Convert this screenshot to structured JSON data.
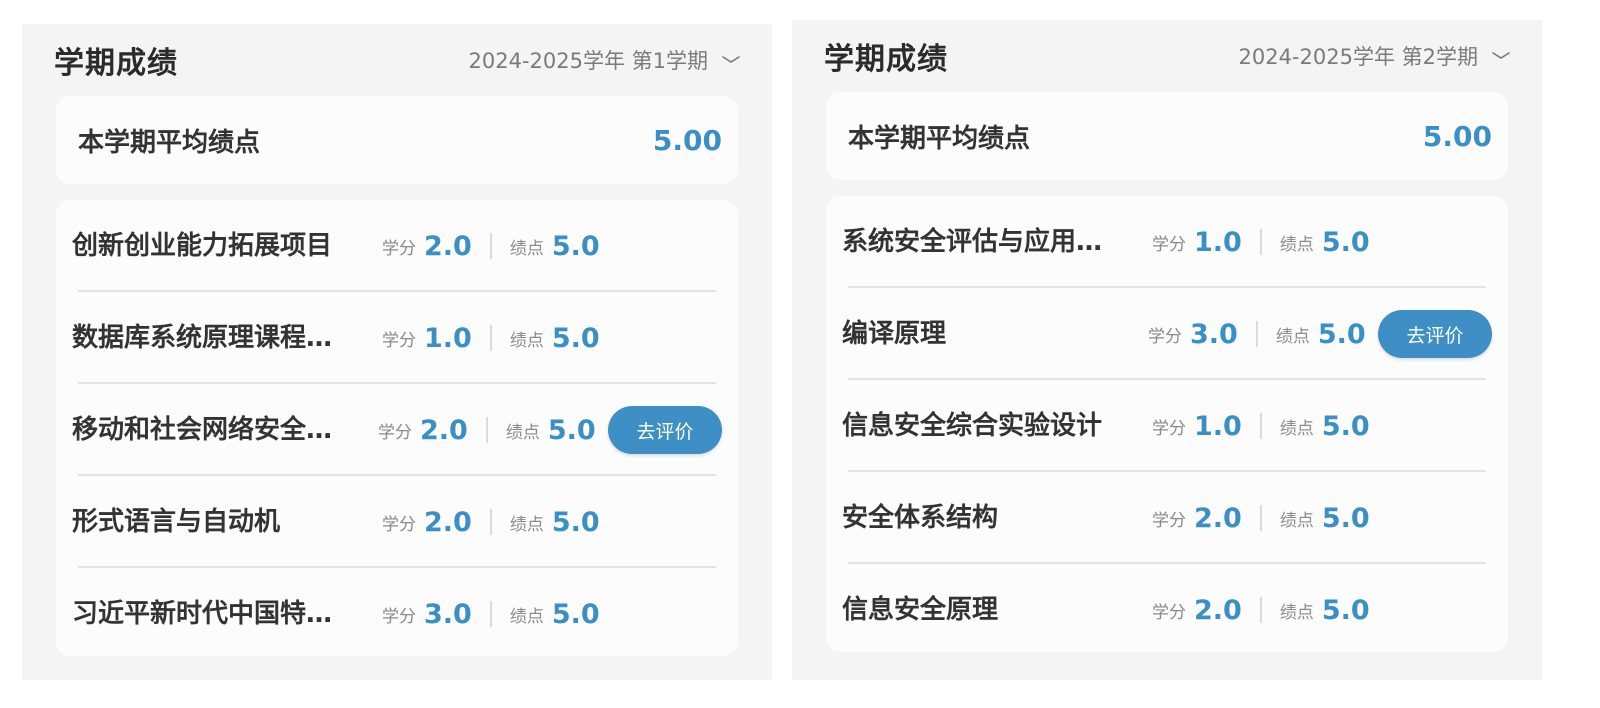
{
  "panels": [
    {
      "title": "学期成绩",
      "term": "2024-2025学年 第1学期",
      "gpa_label": "本学期平均绩点",
      "gpa_value": "5.00",
      "credit_label": "学分",
      "grade_label": "绩点",
      "courses": [
        {
          "name": "创新创业能力拓展项目",
          "credit": "2.0",
          "grade": "5.0"
        },
        {
          "name": "数据库系统原理课程…",
          "credit": "1.0",
          "grade": "5.0"
        },
        {
          "name": "移动和社会网络安全…",
          "credit": "2.0",
          "grade": "5.0",
          "action": "去评价"
        },
        {
          "name": "形式语言与自动机",
          "credit": "2.0",
          "grade": "5.0"
        },
        {
          "name": "习近平新时代中国特…",
          "credit": "3.0",
          "grade": "5.0"
        }
      ]
    },
    {
      "title": "学期成绩",
      "term": "2024-2025学年 第2学期",
      "gpa_label": "本学期平均绩点",
      "gpa_value": "5.00",
      "credit_label": "学分",
      "grade_label": "绩点",
      "courses": [
        {
          "name": "系统安全评估与应用…",
          "credit": "1.0",
          "grade": "5.0"
        },
        {
          "name": "编译原理",
          "credit": "3.0",
          "grade": "5.0",
          "action": "去评价"
        },
        {
          "name": "信息安全综合实验设计",
          "credit": "1.0",
          "grade": "5.0"
        },
        {
          "name": "安全体系结构",
          "credit": "2.0",
          "grade": "5.0"
        },
        {
          "name": "信息安全原理",
          "credit": "2.0",
          "grade": "5.0"
        }
      ]
    }
  ],
  "colors": {
    "accent": "#3a8fc4",
    "panel_bg": "#f4f4f4",
    "card_bg": "#fcfcfc"
  },
  "icons": {
    "term_dropdown": "chevron-down-icon"
  }
}
